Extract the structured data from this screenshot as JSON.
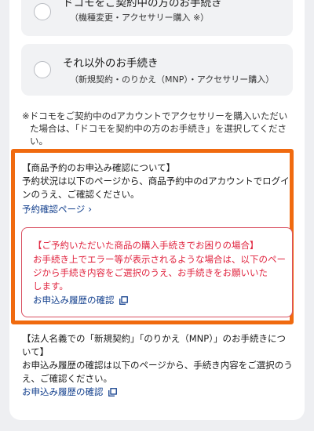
{
  "options": [
    {
      "title": "ドコモをご契約中の方のお手続き",
      "sub": "（機種変更・アクセサリー購入 ※）"
    },
    {
      "title": "それ以外のお手続き",
      "sub": "（新規契約・のりかえ（MNP）・アクセサリー購入）"
    }
  ],
  "note_lines": [
    "※ドコモをご契約中のdアカウントでアクセサリーを購入いただい",
    "た場合は、「ドコモを契約中の方のお手続き」を選択してくださ",
    "い。"
  ],
  "reservation": {
    "heading": "【商品予約のお申込み確認について】",
    "body_lines": [
      "予約状況は以下のページから、商品予約中のdアカウントでログイ",
      "ンのうえ、ご確認ください。"
    ],
    "link_label": "予約確認ページ"
  },
  "alert": {
    "heading": "【ご予約いただいた商品の購入手続きでお困りの場合】",
    "body_lines": [
      "お手続き上でエラー等が表示されるような場合は、以下のペー",
      "ジから手続き内容をご選択のうえ、お手続きをお願いいた",
      "します。"
    ],
    "link_label": "お申込み履歴の確認"
  },
  "corporate": {
    "heading_lines": [
      "【法人名義での「新規契約」「のりかえ（MNP）」のお手続きにつ",
      "いて】"
    ],
    "body_lines": [
      "お申込み履歴の確認は以下のページから、手続き内容をご選択のう",
      "え、ご確認ください。"
    ],
    "link_label": "お申込み履歴の確認"
  },
  "colors": {
    "accent_orange": "#f06a0f",
    "alert_red": "#e0233e",
    "link_blue": "#123f8d"
  },
  "icons": {
    "chevron": "chevron-right-icon",
    "external": "external-link-icon"
  }
}
